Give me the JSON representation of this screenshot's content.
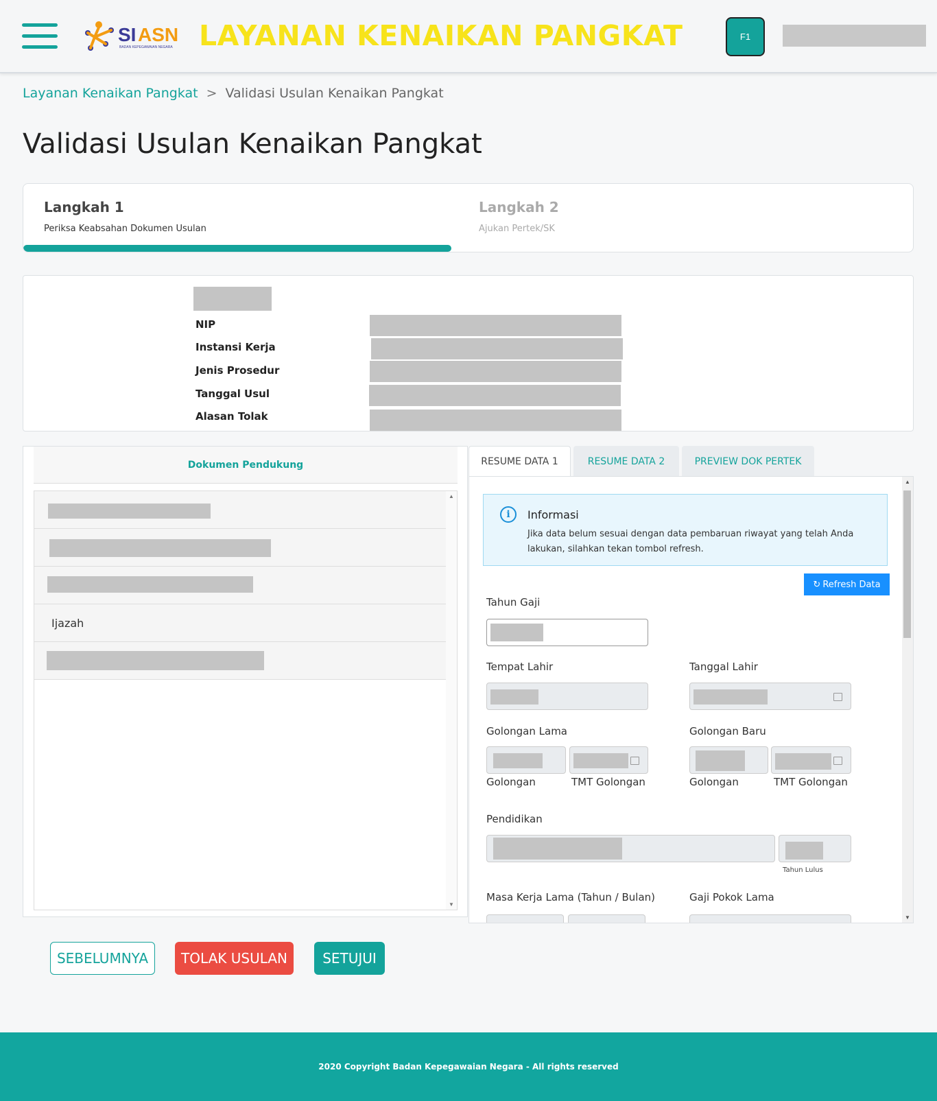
{
  "header": {
    "app_title": "LAYANAN KENAIKAN PANGKAT",
    "logo_text": "SIASN",
    "logo_subtext": "BADAN KEPEGAWAIAN NEGARA",
    "f1_label": "F1",
    "accent_color": "#14a39b",
    "title_color": "#f7e31b"
  },
  "breadcrumb": {
    "parent": "Layanan Kenaikan Pangkat",
    "separator": ">",
    "current": "Validasi Usulan Kenaikan Pangkat"
  },
  "page_title": "Validasi Usulan Kenaikan Pangkat",
  "steps": [
    {
      "title": "Langkah 1",
      "desc": "Periksa Keabsahan Dokumen Usulan",
      "active": true
    },
    {
      "title": "Langkah 2",
      "desc": "Ajukan Pertek/SK",
      "active": false
    }
  ],
  "info": {
    "labels": [
      "NIP",
      "Instansi Kerja",
      "Jenis Prosedur",
      "Tanggal Usul",
      "Alasan Tolak"
    ]
  },
  "documents": {
    "header": "Dokumen Pendukung",
    "items": [
      "",
      "",
      "",
      "Ijazah",
      ""
    ]
  },
  "tabs": [
    "RESUME DATA 1",
    "RESUME DATA 2",
    "PREVIEW DOK PERTEK"
  ],
  "resume": {
    "alert_title": "Informasi",
    "alert_body": "Jika data belum sesuai dengan data pembaruan riwayat yang telah Anda lakukan, silahkan tekan tombol refresh.",
    "refresh_label": "Refresh Data",
    "tahun_gaji": "Tahun Gaji",
    "tempat_lahir": "Tempat Lahir",
    "tanggal_lahir": "Tanggal Lahir",
    "golongan_lama": "Golongan Lama",
    "golongan_baru": "Golongan Baru",
    "golongan": "Golongan",
    "tmt_golongan": "TMT Golongan",
    "pendidikan": "Pendidikan",
    "tahun_lulus": "Tahun Lulus",
    "masa_kerja_lama": "Masa Kerja Lama (Tahun / Bulan)",
    "gaji_pokok_lama": "Gaji Pokok Lama"
  },
  "buttons": {
    "prev": "SEBELUMNYA",
    "reject": "TOLAK USULAN",
    "approve": "SETUJUI"
  },
  "footer": "2020 Copyright Badan Kepegawaian Negara - All rights reserved"
}
